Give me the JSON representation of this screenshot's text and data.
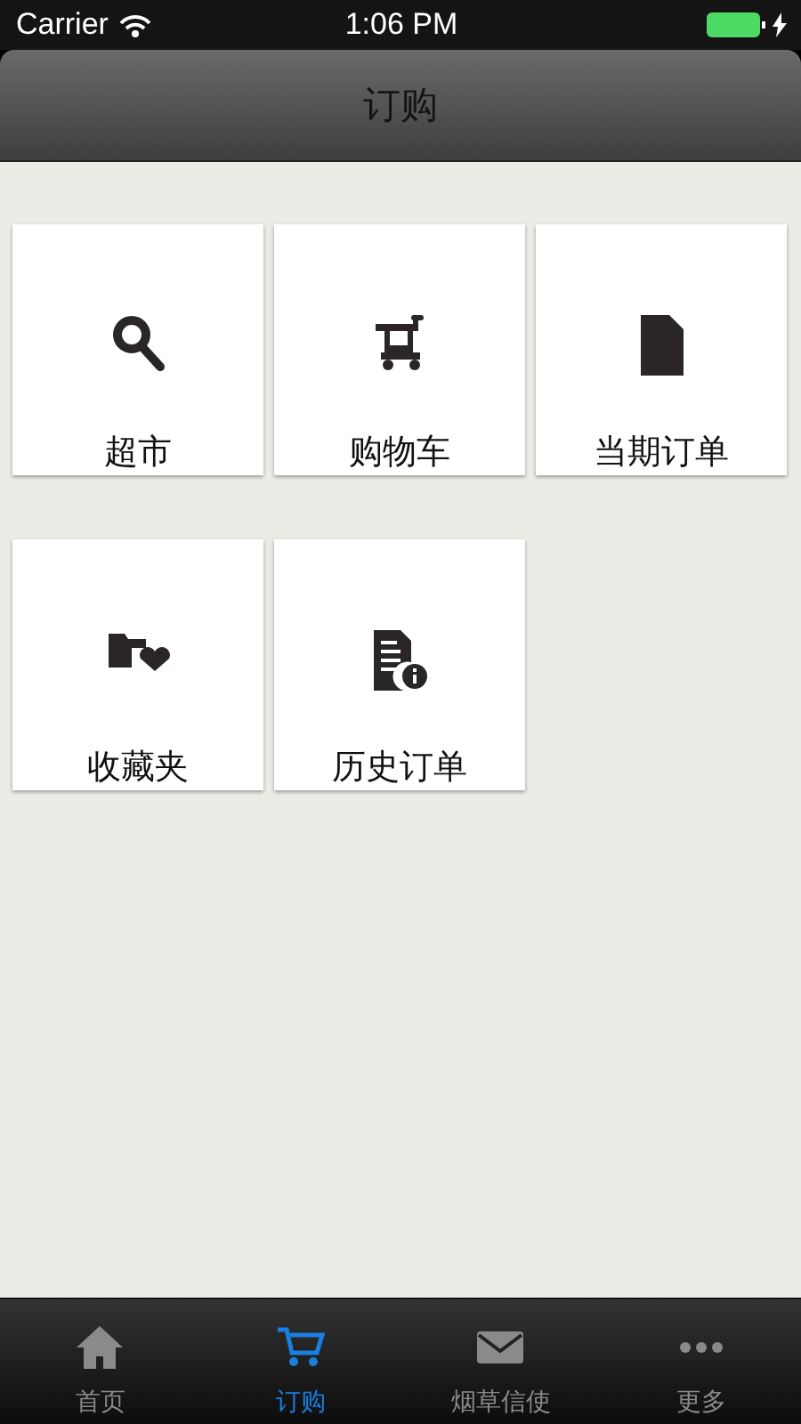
{
  "status_bar": {
    "carrier": "Carrier",
    "time": "1:06 PM"
  },
  "nav_bar": {
    "title": "订购"
  },
  "tiles": [
    {
      "label": "超市",
      "kind": "search"
    },
    {
      "label": "购物车",
      "kind": "cart"
    },
    {
      "label": "当期订单",
      "kind": "document"
    },
    {
      "label": "收藏夹",
      "kind": "favorites"
    },
    {
      "label": "历史订单",
      "kind": "history"
    }
  ],
  "tab_bar": [
    {
      "label": "首页",
      "kind": "home",
      "selected": false
    },
    {
      "label": "订购",
      "kind": "cart",
      "selected": true
    },
    {
      "label": "烟草信使",
      "kind": "message",
      "selected": false
    },
    {
      "label": "更多",
      "kind": "more",
      "selected": false
    }
  ]
}
